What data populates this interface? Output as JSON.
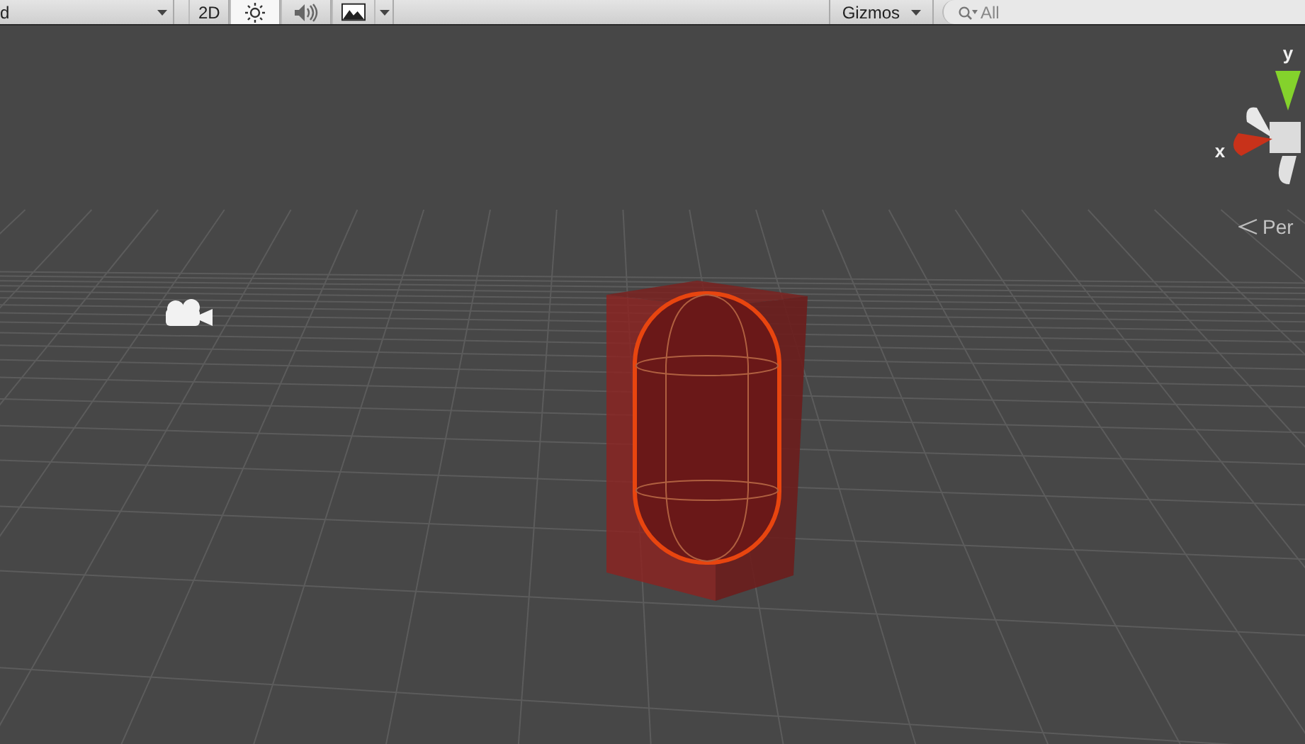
{
  "toolbar": {
    "draw_mode": {
      "label": "d"
    },
    "toggles": [
      {
        "kind": "text",
        "label": "2D",
        "selected": false
      },
      {
        "kind": "lighting",
        "selected": true
      },
      {
        "kind": "audio",
        "selected": false
      },
      {
        "kind": "effects",
        "selected": false
      }
    ],
    "gizmos": {
      "label": "Gizmos"
    },
    "search": {
      "placeholder": "All"
    }
  },
  "scene": {
    "axis_labels": [
      {
        "kind": "y",
        "label": "y"
      },
      {
        "kind": "x",
        "label": "x"
      }
    ],
    "projection": {
      "label": "Per"
    }
  }
}
